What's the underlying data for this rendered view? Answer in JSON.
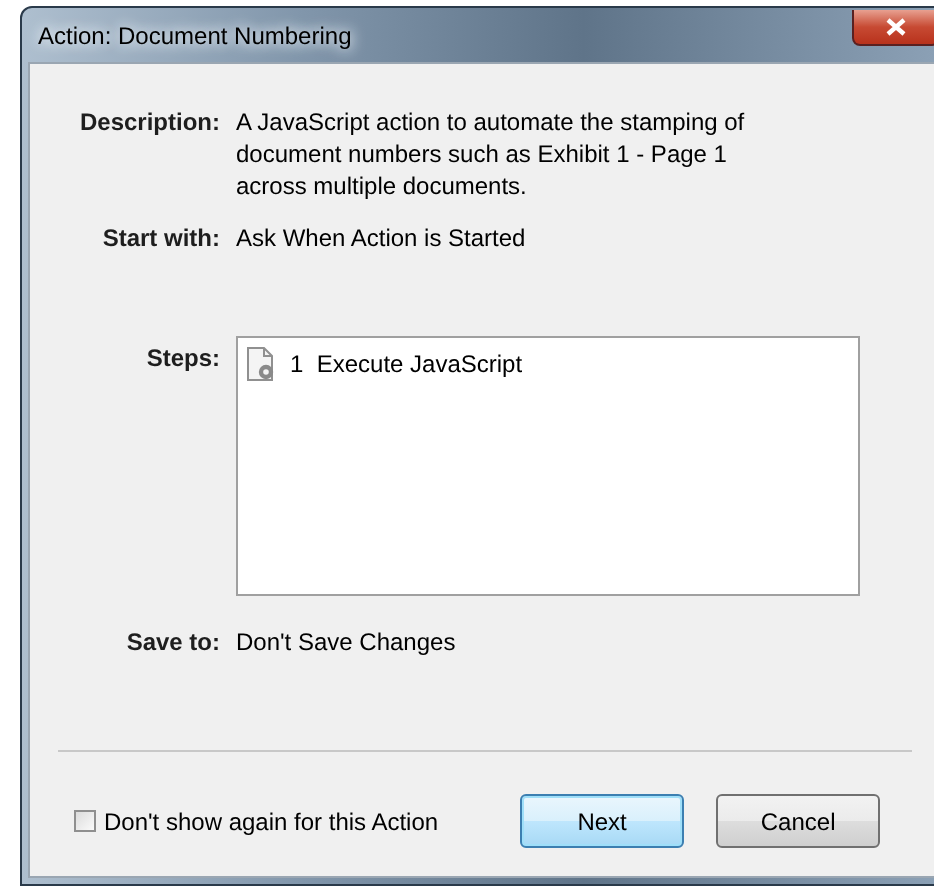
{
  "window": {
    "title": "Action: Document Numbering"
  },
  "fields": [
    {
      "label": "Description:",
      "value": "A JavaScript action to automate the stamping of document numbers such as Exhibit 1 - Page 1 across multiple documents."
    },
    {
      "label": "Start with:",
      "value": "Ask When Action is Started"
    }
  ],
  "steps": {
    "label": "Steps:",
    "items": [
      {
        "number": "1",
        "name": "Execute JavaScript"
      }
    ]
  },
  "save_to": {
    "label": "Save to:",
    "value": "Don't Save Changes"
  },
  "dont_show_again": {
    "label": "Don't show again for this Action",
    "checked": false
  },
  "buttons": [
    {
      "label": "Next",
      "default": true
    },
    {
      "label": "Cancel",
      "default": false
    }
  ]
}
